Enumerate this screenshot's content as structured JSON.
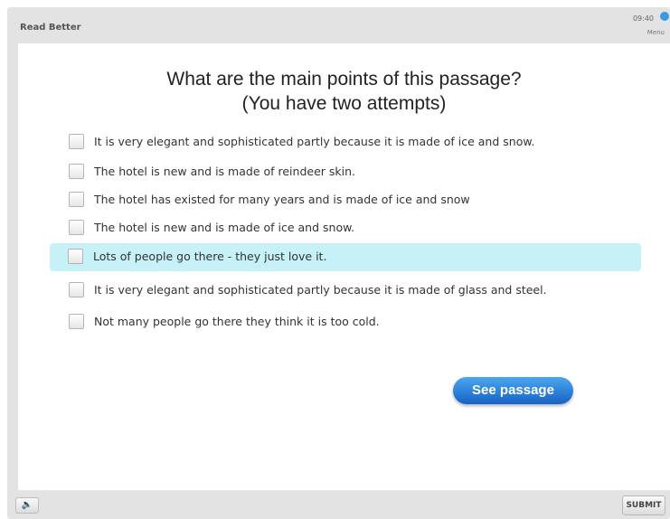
{
  "app": {
    "title": "Read Better",
    "clock": "09:40",
    "menu_label": "Menu"
  },
  "question": {
    "line1": "What are the main points of this passage?",
    "line2": "(You have two attempts)"
  },
  "options": [
    {
      "label": "It is very elegant and sophisticated partly because it is made of ice and snow.",
      "checked": false
    },
    {
      "label": "The hotel is new and is made of reindeer skin.",
      "checked": false
    },
    {
      "label": "The hotel has existed for many years and is made of ice and snow",
      "checked": false
    },
    {
      "label": "The hotel is new and is made of ice and snow.",
      "checked": false
    },
    {
      "label": "Lots of people go there - they just love it.",
      "checked": false,
      "highlighted": true
    },
    {
      "label": "It is very elegant and sophisticated partly because it is made of glass and steel.",
      "checked": false
    },
    {
      "label": "Not many people go there they think it is too cold.",
      "checked": false
    }
  ],
  "buttons": {
    "see_passage": "See passage",
    "submit": "SUBMIT",
    "sound_icon": "speaker-icon"
  },
  "colors": {
    "accent": "#1f7ad8",
    "highlight": "#c6f1f7"
  }
}
